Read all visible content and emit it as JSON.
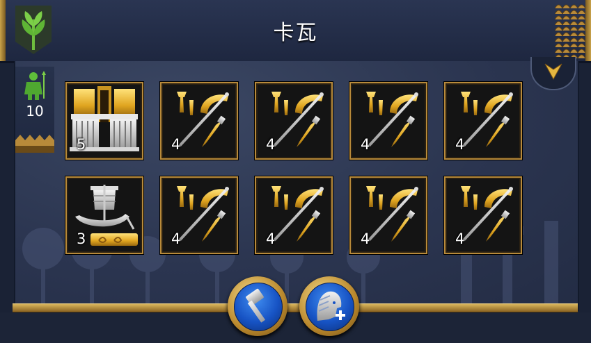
{
  "header": {
    "title": "卡瓦",
    "emblem_icon": "green-wheat-emblem-icon",
    "accent_color": "#c9a24a"
  },
  "troops": {
    "icon": "green-soldier-icon",
    "count": "10"
  },
  "dropdown": {
    "icon": "chevron-down-icon"
  },
  "slots": [
    {
      "type": "temple-building",
      "icon": "golden-temple-icon",
      "count": "5"
    },
    {
      "type": "weapons",
      "icon": "weapons-icon",
      "count": "4"
    },
    {
      "type": "weapons",
      "icon": "weapons-icon",
      "count": "4"
    },
    {
      "type": "weapons",
      "icon": "weapons-icon",
      "count": "4"
    },
    {
      "type": "weapons",
      "icon": "weapons-icon",
      "count": "4"
    },
    {
      "type": "ship",
      "icon": "ship-icon",
      "count": "3"
    },
    {
      "type": "weapons",
      "icon": "weapons-icon",
      "count": "4"
    },
    {
      "type": "weapons",
      "icon": "weapons-icon",
      "count": "4"
    },
    {
      "type": "weapons",
      "icon": "weapons-icon",
      "count": "4"
    },
    {
      "type": "weapons",
      "icon": "weapons-icon",
      "count": "4"
    }
  ],
  "actions": [
    {
      "name": "build",
      "icon": "hammer-icon"
    },
    {
      "name": "recruit",
      "icon": "pharaoh-add-icon"
    }
  ]
}
